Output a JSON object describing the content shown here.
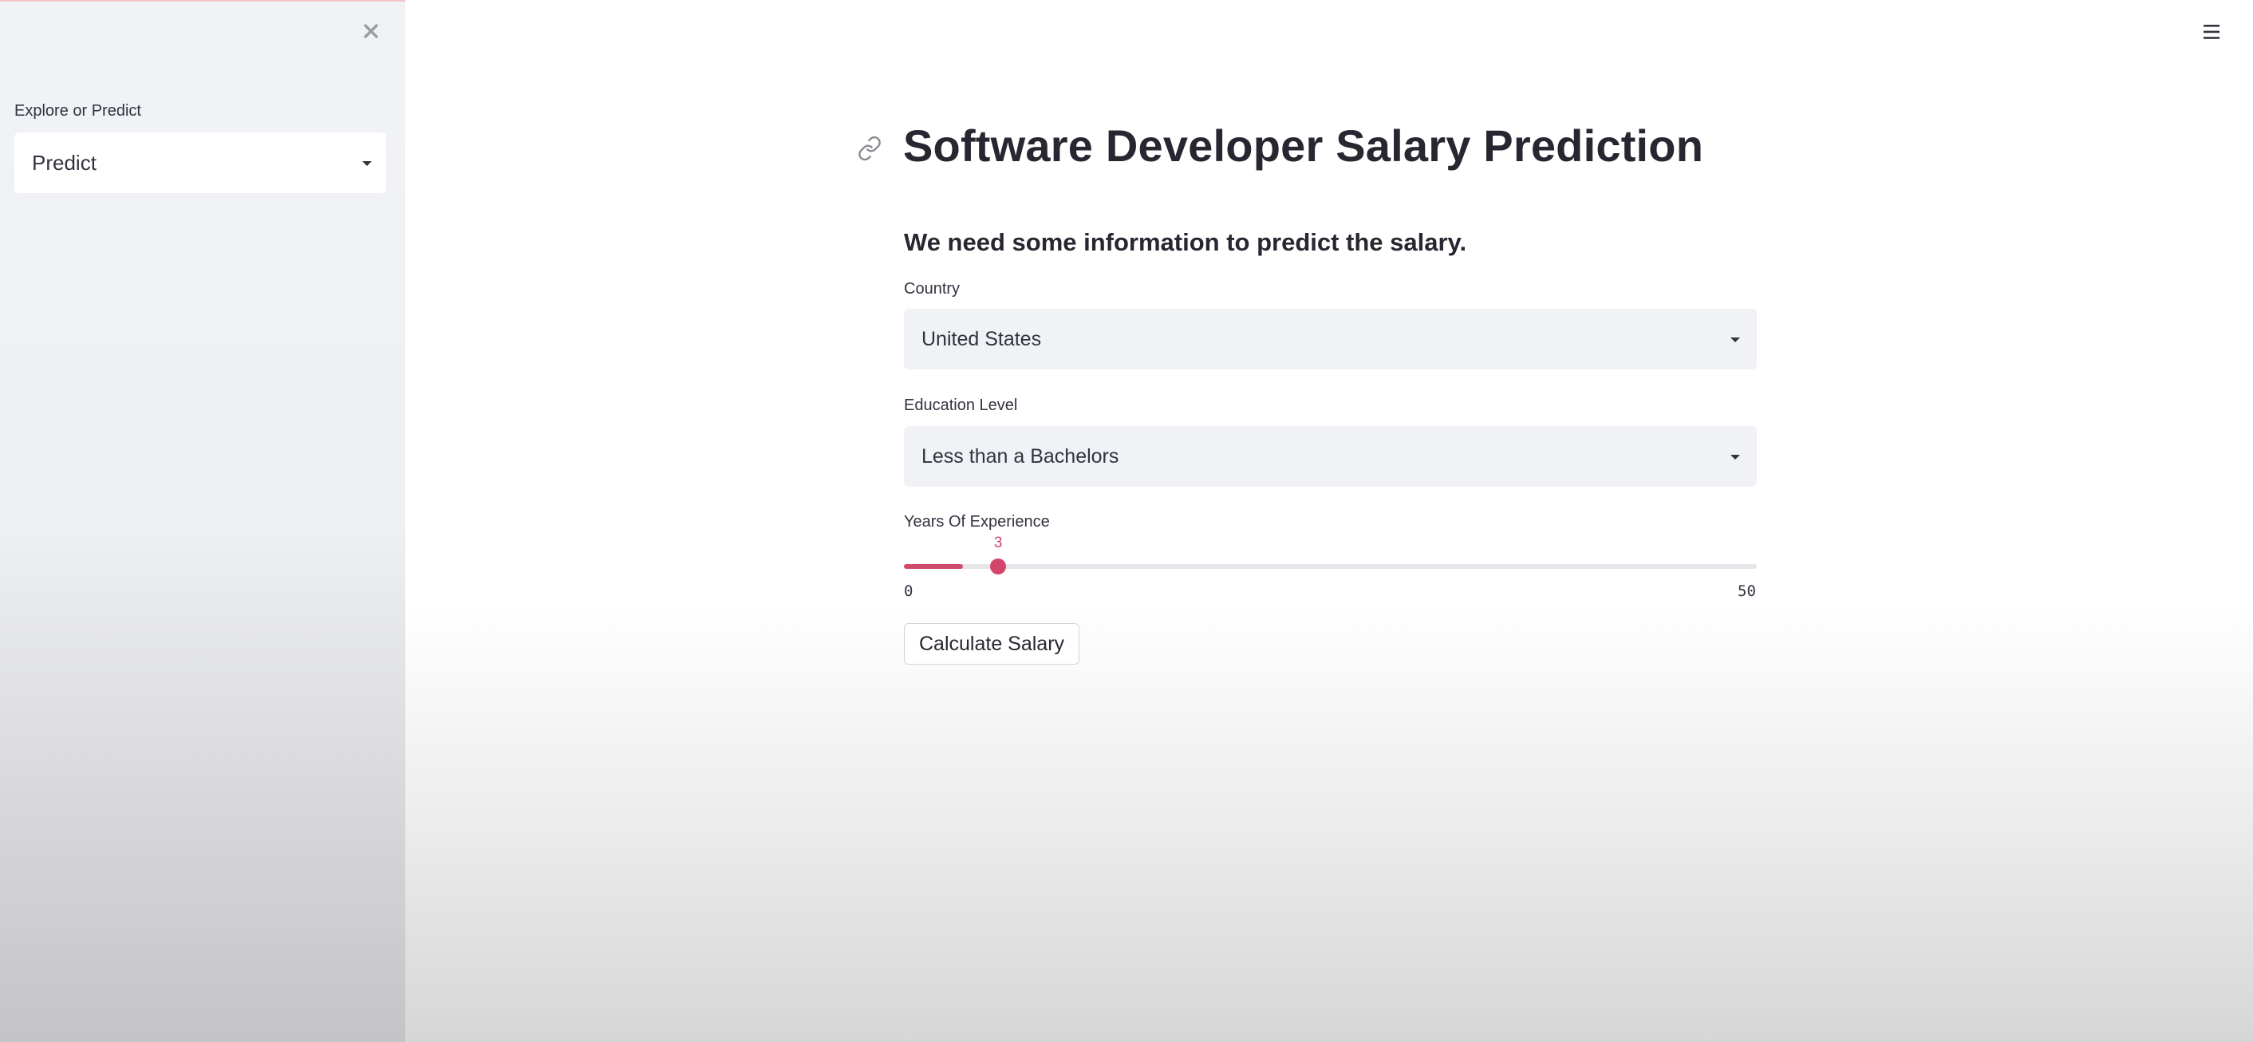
{
  "sidebar": {
    "close_icon": "close-icon",
    "label": "Explore or Predict",
    "select_value": "Predict"
  },
  "header": {
    "menu_icon": "hamburger-menu-icon"
  },
  "main": {
    "anchor_icon": "link-icon",
    "title": "Software Developer Salary Prediction",
    "subheader": "We need some information to predict the salary.",
    "country": {
      "label": "Country",
      "value": "United States"
    },
    "education": {
      "label": "Education Level",
      "value": "Less than a Bachelors"
    },
    "experience": {
      "label": "Years Of Experience",
      "value": 3,
      "min": 0,
      "max": 50,
      "value_text": "3",
      "min_text": "0",
      "max_text": "50"
    },
    "button_label": "Calculate Salary"
  },
  "colors": {
    "accent": "#d1466a",
    "sidebar_bg": "#f0f2f6",
    "input_bg": "#f0f2f6",
    "text": "#262730"
  }
}
